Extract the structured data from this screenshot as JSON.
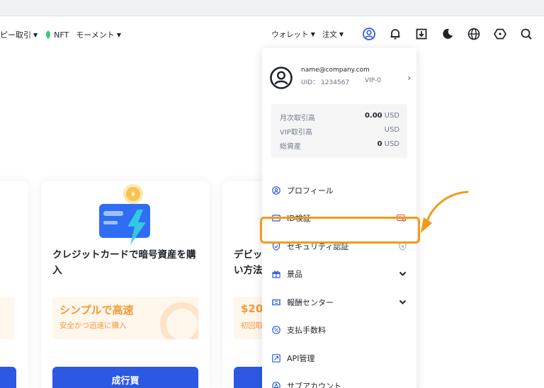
{
  "nav": {
    "left_items": [
      {
        "label": "ピー取引",
        "caret": true
      },
      {
        "label": "NFT",
        "caret": false
      },
      {
        "label": "モーメント",
        "caret": true
      }
    ],
    "right_items": [
      {
        "label": "ウォレット"
      },
      {
        "label": "注文"
      }
    ],
    "icons": [
      "user-icon",
      "bell-icon",
      "download-icon",
      "moon-icon",
      "globe-icon",
      "hexagon-icon",
      "search-icon"
    ]
  },
  "cards": {
    "main": {
      "title": "クレジットカードで暗号資産を購入",
      "promo_title": "シンプルで高速",
      "promo_sub": "安全かつ迅速に購入",
      "button": "成行買"
    },
    "right": {
      "title": "デビッ\nい方法",
      "promo_title": "$20",
      "promo_sub": "初回取"
    }
  },
  "account": {
    "email": "name@company.com",
    "uid_label": "UID：",
    "uid": "1234567",
    "vip": "VIP-0"
  },
  "stats": [
    {
      "label": "月次取引高",
      "value": "0.00",
      "unit": "USD"
    },
    {
      "label": "VIP取引高",
      "value": "",
      "unit": "USD"
    },
    {
      "label": "総資産",
      "value": "0",
      "unit": "USD"
    }
  ],
  "menu": [
    {
      "label": "プロフィール",
      "icon": "profile-icon",
      "right": ""
    },
    {
      "label": "ID検証",
      "icon": "id-card-icon",
      "right": "id-badge-icon"
    },
    {
      "label": "セキュリティ認証",
      "icon": "shield-icon",
      "right": "shield-small-icon"
    },
    {
      "label": "景品",
      "icon": "gift-icon",
      "right": "chevron-down-icon"
    },
    {
      "label": "報酬センター",
      "icon": "ticket-icon",
      "right": "chevron-down-icon"
    },
    {
      "label": "支払手数料",
      "icon": "fee-icon",
      "right": ""
    },
    {
      "label": "API管理",
      "icon": "api-icon",
      "right": ""
    },
    {
      "label": "サブアカウント",
      "icon": "sub-account-icon",
      "right": ""
    }
  ],
  "colors": {
    "accent": "#2d58e3",
    "highlight": "#f29a1c",
    "promo": "#f29a3a"
  }
}
